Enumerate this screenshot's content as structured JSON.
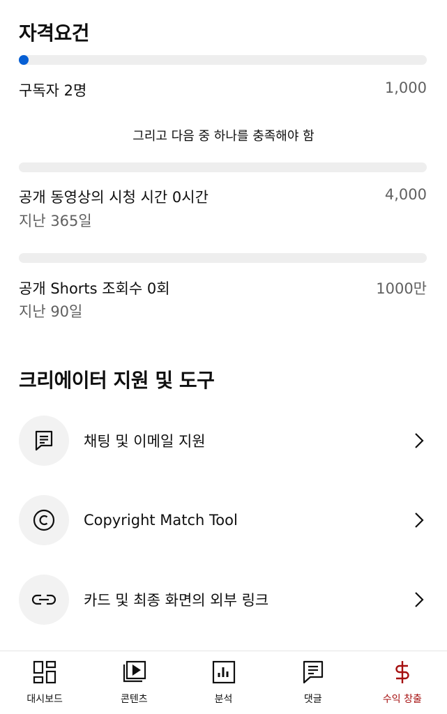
{
  "eligibility": {
    "title": "자격요건",
    "subscribers": {
      "label": "구독자 2명",
      "target": "1,000",
      "progress": 0.002
    },
    "and_text": "그리고 다음 중 하나를 충족해야 함",
    "watch_hours": {
      "label": "공개 동영상의 시청 시간 0시간",
      "sub": "지난 365일",
      "target": "4,000",
      "progress": 0
    },
    "shorts_views": {
      "label": "공개 Shorts 조회수 0회",
      "sub": "지난 90일",
      "target": "1000만",
      "progress": 0
    }
  },
  "tools": {
    "title": "크리에이터 지원 및 도구",
    "items": [
      {
        "label": "채팅 및 이메일 지원",
        "icon": "chat-support-icon"
      },
      {
        "label": "Copyright Match Tool",
        "icon": "copyright-icon"
      },
      {
        "label": "카드 및 최종 화면의 외부 링크",
        "icon": "link-icon"
      }
    ]
  },
  "bottom_nav": {
    "items": [
      {
        "label": "대시보드",
        "icon": "dashboard-icon"
      },
      {
        "label": "콘텐츠",
        "icon": "content-icon"
      },
      {
        "label": "분석",
        "icon": "analytics-icon"
      },
      {
        "label": "댓글",
        "icon": "comments-icon"
      },
      {
        "label": "수익 창출",
        "icon": "earn-icon",
        "active": true
      }
    ]
  },
  "colors": {
    "accent": "#065fd4",
    "active_nav": "#a50f0f",
    "track": "#eeeeee",
    "secondary_text": "#606060"
  }
}
